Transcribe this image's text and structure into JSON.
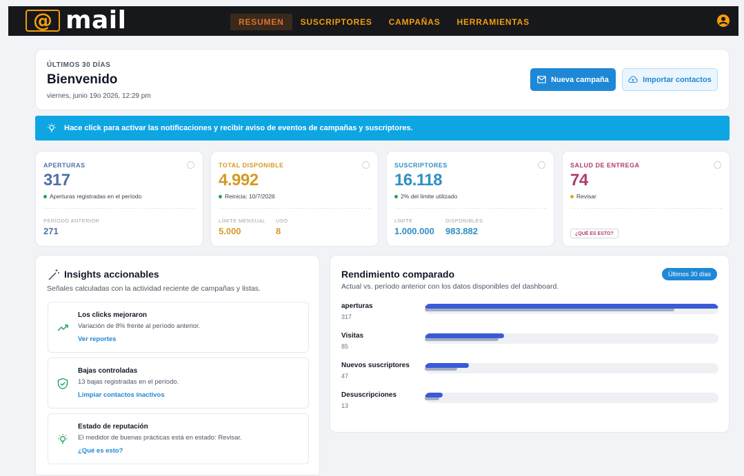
{
  "header": {
    "logo_text": "mail",
    "logo_symbol": "@",
    "nav": [
      {
        "label": "RESUMEN",
        "active": true
      },
      {
        "label": "SUSCRIPTORES",
        "active": false
      },
      {
        "label": "CAMPAÑAS",
        "active": false
      },
      {
        "label": "HERRAMIENTAS",
        "active": false
      }
    ],
    "user_icon": "user-icon"
  },
  "welcome": {
    "overline": "ÚLTIMOS 30 DÍAS",
    "title": "Bienvenido",
    "date": "viernes, junio 19o 2026, 12:29 pm",
    "new_campaign": "Nueva campaña",
    "import_contacts": "Importar contactos"
  },
  "banner": {
    "text": "Hace click para activar las notificaciones y recibir aviso de eventos de campañas y suscriptores.",
    "icon": "lightbulb-icon"
  },
  "stats": [
    {
      "label": "APERTURAS",
      "value": "317",
      "note": "Aperturas registradas en el período",
      "color": "#4f6fa8",
      "dot": "#22a35a",
      "subs": [
        {
          "label": "PERÍODO ANTERIOR",
          "value": "271"
        }
      ]
    },
    {
      "label": "TOTAL DISPONIBLE",
      "value": "4.992",
      "note": "Reinicia: 10/7/2026",
      "color": "#d49a24",
      "dot": "#22a35a",
      "subs": [
        {
          "label": "LÍMITE MENSUAL",
          "value": "5.000"
        },
        {
          "label": "USO",
          "value": "8"
        }
      ]
    },
    {
      "label": "SUSCRIPTORES",
      "value": "16.118",
      "note": "2% del límite utilizado",
      "color": "#2f8fc2",
      "dot": "#22a35a",
      "subs": [
        {
          "label": "LÍMITE",
          "value": "1.000.000"
        },
        {
          "label": "DISPONIBLES",
          "value": "983.882"
        }
      ]
    },
    {
      "label": "SALUD DE ENTREGA",
      "value": "74",
      "note": "Revisar",
      "color": "#b03a6f",
      "dot": "#e6a020",
      "button": "¿QUÉ ES ESTO?"
    }
  ],
  "insights": {
    "title": "Insights accionables",
    "subtitle": "Señales calculadas con la actividad reciente de campañas y listas.",
    "items": [
      {
        "title": "Los clicks mejoraron",
        "desc": "Variación de 8% frente al período anterior.",
        "link": "Ver reportes",
        "icon": "trend-up-icon"
      },
      {
        "title": "Bajas controladas",
        "desc": "13 bajas registradas en el período.",
        "link": "Limpiar contactos inactivos",
        "icon": "shield-check-icon"
      },
      {
        "title": "Estado de reputación",
        "desc": "El medidor de buenas prácticas está en estado: Revisar.",
        "link": "¿Qué es esto?",
        "icon": "lightbulb-icon"
      }
    ]
  },
  "performance": {
    "title": "Rendimiento comparado",
    "subtitle": "Actual vs. período anterior con los datos disponibles del dashboard.",
    "period": "Últimos 30 días",
    "rows": [
      {
        "label": "aperturas",
        "value": "317",
        "current": 1.0,
        "previous": 0.85
      },
      {
        "label": "Visitas",
        "value": "85",
        "current": 0.27,
        "previous": 0.25
      },
      {
        "label": "Nuevos suscriptores",
        "value": "47",
        "current": 0.15,
        "previous": 0.11
      },
      {
        "label": "Desuscripciones",
        "value": "13",
        "current": 0.06,
        "previous": 0.05
      }
    ]
  },
  "colors": {
    "accent": "#f59e0b",
    "primary": "#1e88d6",
    "banner": "#0ea5e3",
    "bar": "#3a5bd9"
  }
}
